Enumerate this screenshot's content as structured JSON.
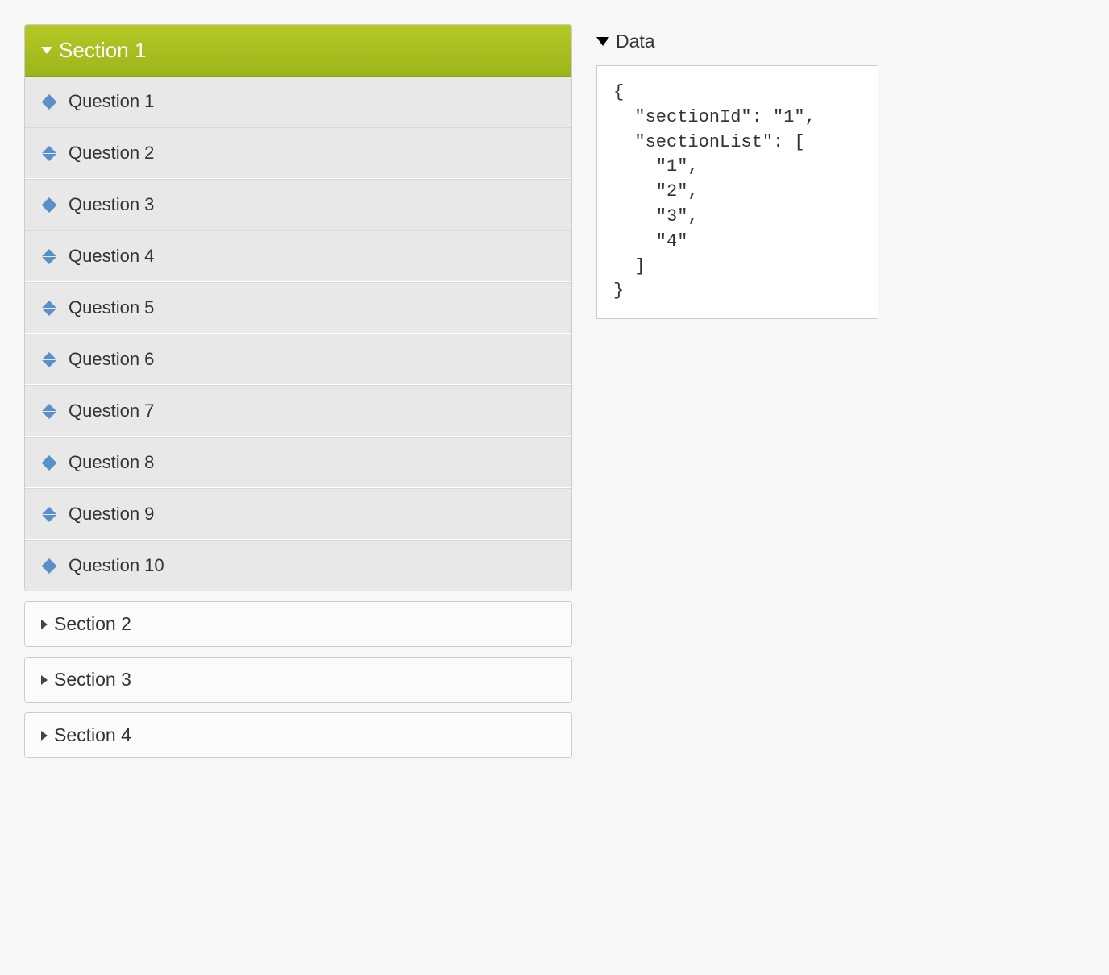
{
  "sections": [
    {
      "label": "Section 1",
      "expanded": true,
      "questions": [
        "Question 1",
        "Question 2",
        "Question 3",
        "Question 4",
        "Question 5",
        "Question 6",
        "Question 7",
        "Question 8",
        "Question 9",
        "Question 10"
      ]
    },
    {
      "label": "Section 2",
      "expanded": false,
      "questions": []
    },
    {
      "label": "Section 3",
      "expanded": false,
      "questions": []
    },
    {
      "label": "Section 4",
      "expanded": false,
      "questions": []
    }
  ],
  "dataPanel": {
    "title": "Data",
    "content": "{\n  \"sectionId\": \"1\",\n  \"sectionList\": [\n    \"1\",\n    \"2\",\n    \"3\",\n    \"4\"\n  ]\n}"
  }
}
